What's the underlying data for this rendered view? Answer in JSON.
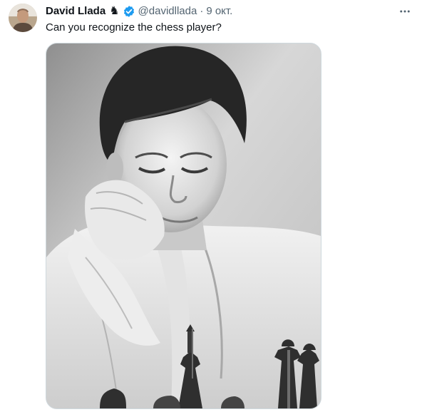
{
  "tweet": {
    "author": {
      "name": "David Llada",
      "emoji": "♞",
      "handle": "@davidllada"
    },
    "separator": "·",
    "date": "9 окт.",
    "text": "Can you recognize the chess player?"
  },
  "icons": {
    "avatar": "avatar-photo",
    "verified": "verified-badge-icon",
    "more": "more-horizontal-icon"
  },
  "colors": {
    "verified": "#1d9bf0",
    "secondary_text": "#536471",
    "primary_text": "#0f1419",
    "border": "#cfd9de"
  }
}
